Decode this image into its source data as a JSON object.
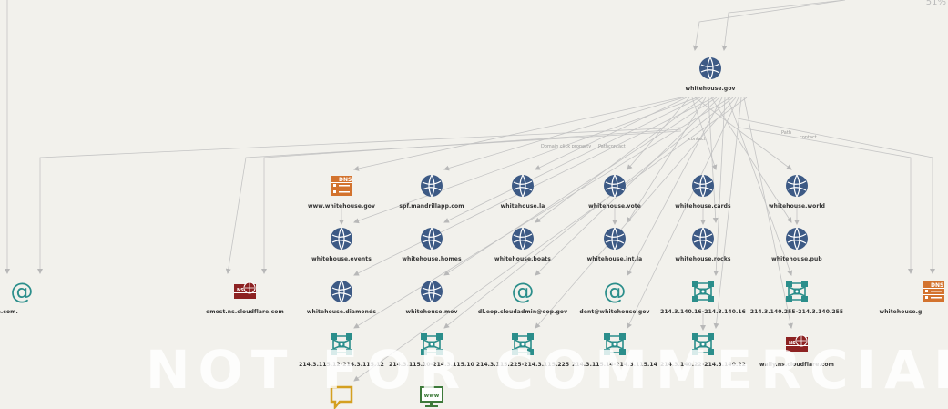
{
  "zoom_text": "51%",
  "watermark": "NOT FOR COMMERCIAL USE",
  "colors": {
    "domain": "#3d5a85",
    "email": "#2b8e8b",
    "netblock": "#2b8e8b",
    "ns": "#8d2222",
    "dns": "#d3732e",
    "phrase": "#d4a020",
    "website": "#3d7a3a",
    "edge": "#c4c4c4"
  },
  "nodes": [
    {
      "id": "root",
      "type": "domain",
      "label": "whitehouse.gov"
    },
    {
      "id": "n_email1",
      "type": "email",
      "label": "s@cloudflare.com."
    },
    {
      "id": "n_ns1",
      "type": "ns",
      "label": "emest.ns.cloudflare.com"
    },
    {
      "id": "n_www",
      "type": "dns",
      "label": "www.whitehouse.gov"
    },
    {
      "id": "n_spf",
      "type": "domain",
      "label": "spf.mandrillapp.com"
    },
    {
      "id": "n_la",
      "type": "domain",
      "label": "whitehouse.la"
    },
    {
      "id": "n_vote",
      "type": "domain",
      "label": "whitehouse.vote"
    },
    {
      "id": "n_cards",
      "type": "domain",
      "label": "whitehouse.cards"
    },
    {
      "id": "n_world",
      "type": "domain",
      "label": "whitehouse.world"
    },
    {
      "id": "n_dns_r",
      "type": "dns",
      "label": "whitehouse.g"
    },
    {
      "id": "n_events",
      "type": "domain",
      "label": "whitehouse.events"
    },
    {
      "id": "n_homes",
      "type": "domain",
      "label": "whitehouse.homes"
    },
    {
      "id": "n_boats",
      "type": "domain",
      "label": "whitehouse.boats"
    },
    {
      "id": "n_intla",
      "type": "domain",
      "label": "whitehouse.int.la"
    },
    {
      "id": "n_rocks",
      "type": "domain",
      "label": "whitehouse.rocks"
    },
    {
      "id": "n_pub",
      "type": "domain",
      "label": "whitehouse.pub"
    },
    {
      "id": "n_diamonds",
      "type": "domain",
      "label": "whitehouse.diamonds"
    },
    {
      "id": "n_mov",
      "type": "domain",
      "label": "whitehouse.mov"
    },
    {
      "id": "n_email2",
      "type": "email",
      "label": "dl.eop.cloudadmin@eop.gov"
    },
    {
      "id": "n_email3",
      "type": "email",
      "label": "dent@whitehouse.gov"
    },
    {
      "id": "n_nb1",
      "type": "netblock",
      "label": "214.3.140.16-214.3.140.16"
    },
    {
      "id": "n_nb2",
      "type": "netblock",
      "label": "214.3.140.255-214.3.140.255"
    },
    {
      "id": "n_nb3",
      "type": "netblock",
      "label": "214.3.115.12-214.3.115.12"
    },
    {
      "id": "n_nb4",
      "type": "netblock",
      "label": "214.3.115.10-214.3.115.10"
    },
    {
      "id": "n_nb5",
      "type": "netblock",
      "label": "214.3.115.225-214.3.115.225"
    },
    {
      "id": "n_nb6",
      "type": "netblock",
      "label": "214.3.115.14-214.3.115.14"
    },
    {
      "id": "n_nb7",
      "type": "netblock",
      "label": "214.3.140.22-214.3.140.22"
    },
    {
      "id": "n_ns2",
      "type": "ns",
      "label": "wally.ns.cloudflare.com"
    },
    {
      "id": "n_phrase",
      "type": "phrase",
      "label": ""
    },
    {
      "id": "n_web",
      "type": "website",
      "label": ""
    }
  ],
  "edge_labels": [
    "Domain click property",
    "Path",
    "contact",
    "contact",
    "Path",
    "contact"
  ],
  "icon_text": {
    "dns": "DNS",
    "website": "www",
    "ns": "NS",
    "email": "@"
  }
}
